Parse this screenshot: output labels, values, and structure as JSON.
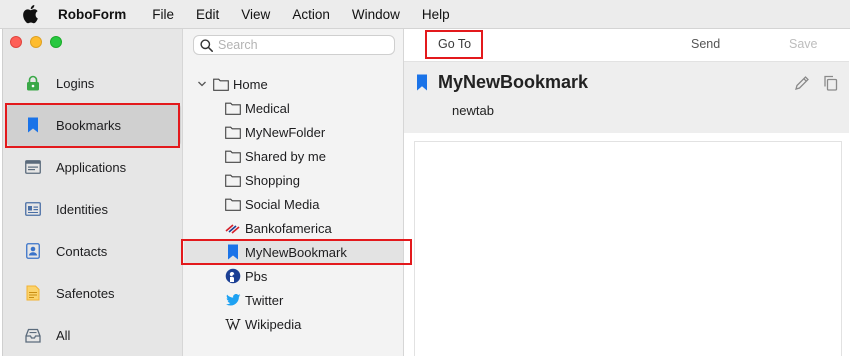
{
  "menubar": {
    "app_name": "RoboForm",
    "items": [
      "File",
      "Edit",
      "View",
      "Action",
      "Window",
      "Help"
    ]
  },
  "sidebar": {
    "items": [
      {
        "label": "Logins",
        "icon": "lock-icon",
        "color": "#3aa847"
      },
      {
        "label": "Bookmarks",
        "icon": "bookmark-icon",
        "color": "#1a73e8"
      },
      {
        "label": "Applications",
        "icon": "application-window-icon",
        "color": "#5b6b7c"
      },
      {
        "label": "Identities",
        "icon": "id-card-icon",
        "color": "#4a6fa5"
      },
      {
        "label": "Contacts",
        "icon": "contact-card-icon",
        "color": "#3a73c9"
      },
      {
        "label": "Safenotes",
        "icon": "note-icon",
        "color": "#f2b233"
      },
      {
        "label": "All",
        "icon": "inbox-tray-icon",
        "color": "#5b6b7c"
      }
    ],
    "active": "Bookmarks"
  },
  "tree": {
    "search_placeholder": "Search",
    "root": "Home",
    "items": [
      {
        "label": "Medical",
        "icon": "folder-icon"
      },
      {
        "label": "MyNewFolder",
        "icon": "folder-icon"
      },
      {
        "label": "Shared by me",
        "icon": "folder-icon"
      },
      {
        "label": "Shopping",
        "icon": "folder-icon"
      },
      {
        "label": "Social Media",
        "icon": "folder-icon"
      },
      {
        "label": "Bankofamerica",
        "icon": "bankofamerica-logo-icon"
      },
      {
        "label": "MyNewBookmark",
        "icon": "bookmark-icon"
      },
      {
        "label": "Pbs",
        "icon": "pbs-logo-icon"
      },
      {
        "label": "Twitter",
        "icon": "twitter-bird-icon"
      },
      {
        "label": "Wikipedia",
        "icon": "wikipedia-w-icon"
      }
    ],
    "selected": "MyNewBookmark"
  },
  "detail": {
    "toolbar": {
      "goto_label": "Go To",
      "send_label": "Send",
      "save_label": "Save"
    },
    "title": "MyNewBookmark",
    "subtitle": "newtab"
  },
  "colors": {
    "highlight": "#e3191c",
    "accent_blue": "#1a73e8"
  }
}
